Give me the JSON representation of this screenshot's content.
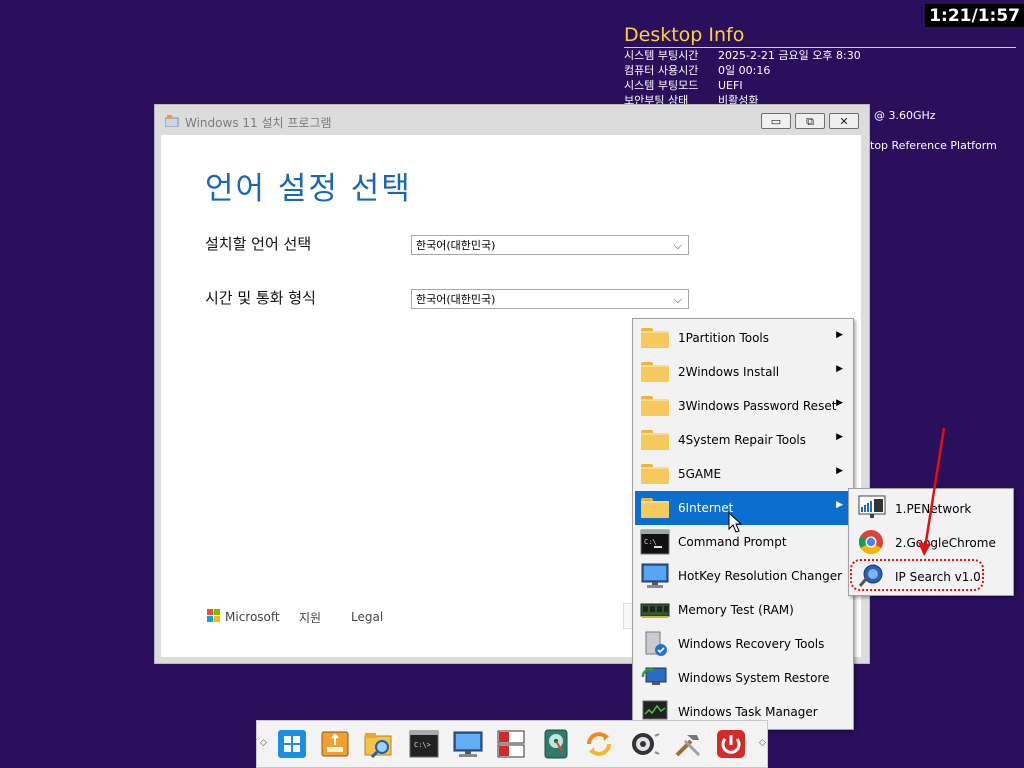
{
  "timer": "1:21/1:57",
  "desktop_info": {
    "title": "Desktop Info",
    "rows": [
      {
        "key": "시스템 부팅시간",
        "value": "2025-2-21 금요일 오후 8:30"
      },
      {
        "key": "컴퓨터 사용시간",
        "value": "0일 00:16"
      },
      {
        "key": "시스템 부팅모드",
        "value": "UEFI"
      },
      {
        "key": "보안부팅 상태",
        "value": "비활성화"
      }
    ],
    "cpu_fragment": "@ 3.60GHz",
    "platform_fragment": "top Reference Platform"
  },
  "setup_window": {
    "title": "Windows 11 설치 프로그램",
    "heading": "언어 설정 선택",
    "language_label": "설치할 언어 선택",
    "language_value": "한국어(대한민국)",
    "time_label": "시간 및 통화 형식",
    "time_value": "한국어(대한민국)",
    "brand": "Microsoft",
    "support": "지원",
    "legal": "Legal",
    "btn_minimize": "▭",
    "btn_restore": "⧉",
    "btn_close": "✕"
  },
  "menu": {
    "items": [
      {
        "label": "1Partition Tools",
        "icon": "folder-icon",
        "submenu": true
      },
      {
        "label": "2Windows Install",
        "icon": "folder-icon",
        "submenu": true
      },
      {
        "label": "3Windows Password Reset",
        "icon": "folder-icon",
        "submenu": true
      },
      {
        "label": "4System Repair Tools",
        "icon": "folder-icon",
        "submenu": true
      },
      {
        "label": "5GAME",
        "icon": "folder-icon",
        "submenu": true
      },
      {
        "label": "6Internet",
        "icon": "folder-icon",
        "submenu": true,
        "selected": true
      },
      {
        "label": "Command Prompt",
        "icon": "command-prompt-icon"
      },
      {
        "label": "HotKey Resolution Changer",
        "icon": "monitor-icon"
      },
      {
        "label": "Memory Test (RAM)",
        "icon": "memory-chip-icon"
      },
      {
        "label": "Windows Recovery Tools",
        "icon": "recovery-icon"
      },
      {
        "label": "Windows System Restore",
        "icon": "system-restore-icon"
      },
      {
        "label": "Windows Task Manager",
        "icon": "task-manager-icon"
      }
    ],
    "arrow_glyph": "▶"
  },
  "submenu": {
    "items": [
      {
        "label": "1.PENetwork",
        "icon": "network-icon"
      },
      {
        "label": "2.GoogleChrome",
        "icon": "chrome-icon"
      },
      {
        "label": "IP Search v1.0",
        "icon": "ip-search-icon"
      }
    ]
  },
  "taskbar": {
    "left_arrow": "◇",
    "right_arrow": "◇",
    "items": [
      "windows-start-icon",
      "usb-drive-icon",
      "file-explorer-icon",
      "command-prompt-icon",
      "monitor-icon",
      "partition-tool-icon",
      "disk-icon",
      "sync-icon",
      "settings-icon",
      "tools-icon",
      "power-icon"
    ]
  },
  "colors": {
    "desktop": "#2a0f5c",
    "accent": "#0c6fd0",
    "heading": "#1a66b8",
    "info_title": "#ffd23c",
    "highlight": "#e01010"
  }
}
